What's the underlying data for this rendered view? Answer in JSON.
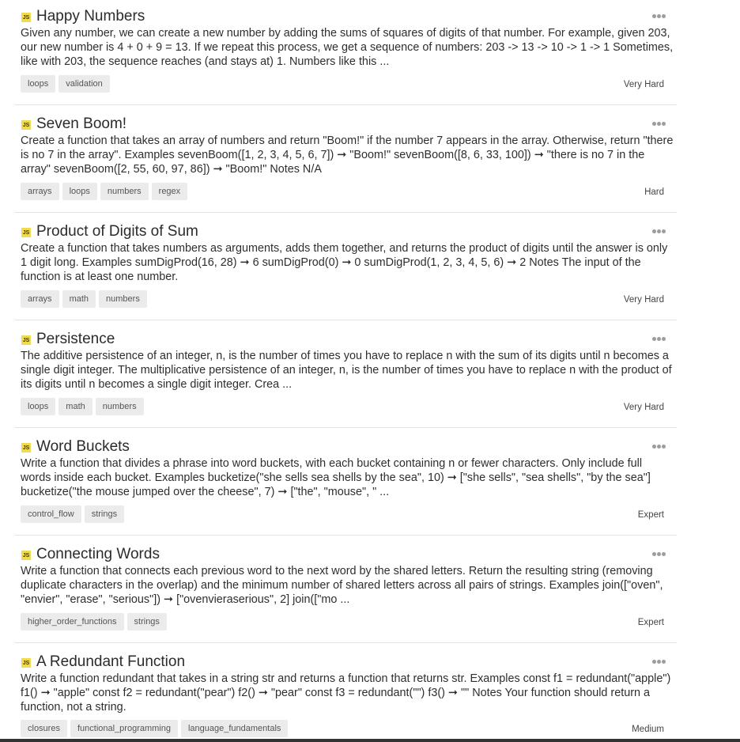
{
  "challenges": [
    {
      "language_badge": "JS",
      "title": "Happy Numbers",
      "description": "Given any number, we can create a new number by adding the sums of squares of digits of that number. For example, given 203, our new number is 4 + 0 + 9 = 13. If we repeat this process, we get a sequence of numbers: 203 -> 13 -> 10 -> 1 -> 1 Sometimes, like with 203, the sequence reaches (and stays at) 1. Numbers like this ...",
      "tags": [
        "loops",
        "validation"
      ],
      "difficulty": "Very Hard"
    },
    {
      "language_badge": "JS",
      "title": "Seven Boom!",
      "description": "Create a function that takes an array of numbers and return \"Boom!\" if the number 7 appears in the array. Otherwise, return \"there is no 7 in the array\". Examples sevenBoom([1, 2, 3, 4, 5, 6, 7]) ➞ \"Boom!\" sevenBoom([8, 6, 33, 100]) ➞ \"there is no 7 in the array\" sevenBoom([2, 55, 60, 97, 86]) ➞ \"Boom!\" Notes N/A",
      "tags": [
        "arrays",
        "loops",
        "numbers",
        "regex"
      ],
      "difficulty": "Hard"
    },
    {
      "language_badge": "JS",
      "title": "Product of Digits of Sum",
      "description": "Create a function that takes numbers as arguments, adds them together, and returns the product of digits until the answer is only 1 digit long. Examples sumDigProd(16, 28) ➞ 6 sumDigProd(0) ➞ 0 sumDigProd(1, 2, 3, 4, 5, 6) ➞ 2 Notes The input of the function is at least one number.",
      "tags": [
        "arrays",
        "math",
        "numbers"
      ],
      "difficulty": "Very Hard"
    },
    {
      "language_badge": "JS",
      "title": "Persistence",
      "description": "The additive persistence of an integer, n, is the number of times you have to replace n with the sum of its digits until n becomes a single digit integer. The multiplicative persistence of an integer, n, is the number of times you have to replace n with the product of its digits until n becomes a single digit integer. Crea ...",
      "tags": [
        "loops",
        "math",
        "numbers"
      ],
      "difficulty": "Very Hard"
    },
    {
      "language_badge": "JS",
      "title": "Word Buckets",
      "description": "Write a function that divides a phrase into word buckets, with each bucket containing n or fewer characters. Only include full words inside each bucket. Examples bucketize(\"she sells sea shells by the sea\", 10) ➞ [\"she sells\", \"sea shells\", \"by the sea\"] bucketize(\"the mouse jumped over the cheese\", 7) ➞ [\"the\", \"mouse\", \" ...",
      "tags": [
        "control_flow",
        "strings"
      ],
      "difficulty": "Expert"
    },
    {
      "language_badge": "JS",
      "title": "Connecting Words",
      "description": "Write a function that connects each previous word to the next word by the shared letters. Return the resulting string (removing duplicate characters in the overlap) and the minimum number of shared letters across all pairs of strings. Examples join([\"oven\", \"envier\", \"erase\", \"serious\"]) ➞ [\"ovenvieraserious\", 2] join([\"mo ...",
      "tags": [
        "higher_order_functions",
        "strings"
      ],
      "difficulty": "Expert"
    },
    {
      "language_badge": "JS",
      "title": "A Redundant Function",
      "description": "Write a function redundant that takes in a string str and returns a function that returns str. Examples const f1 = redundant(\"apple\") f1() ➞ \"apple\" const f2 = redundant(\"pear\") f2() ➞ \"pear\" const f3 = redundant(\"\") f3() ➞ \"\" Notes Your function should return a function, not a string.",
      "tags": [
        "closures",
        "functional_programming",
        "language_fundamentals"
      ],
      "difficulty": "Medium"
    }
  ]
}
